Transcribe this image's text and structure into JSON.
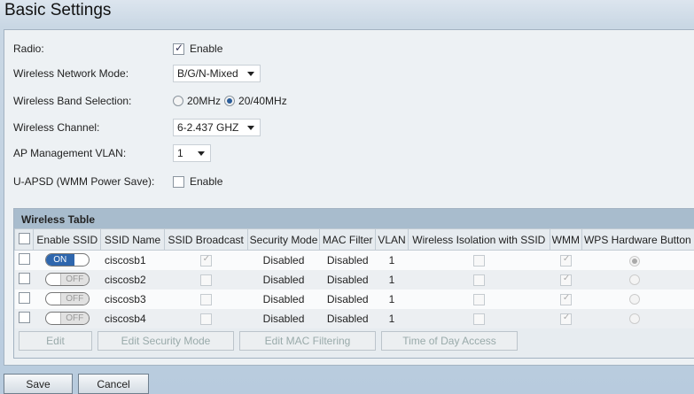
{
  "title": "Basic Settings",
  "form": {
    "radio": {
      "label": "Radio:",
      "checkbox_label": "Enable",
      "checked": true
    },
    "mode": {
      "label": "Wireless Network Mode:",
      "value": "B/G/N-Mixed"
    },
    "band": {
      "label": "Wireless Band Selection:",
      "options": [
        "20MHz",
        "20/40MHz"
      ],
      "selected": "20/40MHz"
    },
    "channel": {
      "label": "Wireless Channel:",
      "value": "6-2.437 GHZ"
    },
    "vlan": {
      "label": "AP Management VLAN:",
      "value": "1"
    },
    "uapsd": {
      "label": "U-APSD (WMM Power Save):",
      "checkbox_label": "Enable",
      "checked": false
    }
  },
  "table": {
    "title": "Wireless Table",
    "columns": [
      "Enable SSID",
      "SSID Name",
      "SSID Broadcast",
      "Security Mode",
      "MAC Filter",
      "VLAN",
      "Wireless Isolation with SSID",
      "WMM",
      "WPS Hardware Button"
    ],
    "rows": [
      {
        "enabled": "ON",
        "name": "ciscosb1",
        "broadcast": true,
        "security": "Disabled",
        "mac": "Disabled",
        "vlan": "1",
        "isolation": false,
        "wmm": true,
        "wps": true
      },
      {
        "enabled": "OFF",
        "name": "ciscosb2",
        "broadcast": false,
        "security": "Disabled",
        "mac": "Disabled",
        "vlan": "1",
        "isolation": false,
        "wmm": true,
        "wps": false
      },
      {
        "enabled": "OFF",
        "name": "ciscosb3",
        "broadcast": false,
        "security": "Disabled",
        "mac": "Disabled",
        "vlan": "1",
        "isolation": false,
        "wmm": true,
        "wps": false
      },
      {
        "enabled": "OFF",
        "name": "ciscosb4",
        "broadcast": false,
        "security": "Disabled",
        "mac": "Disabled",
        "vlan": "1",
        "isolation": false,
        "wmm": true,
        "wps": false
      }
    ],
    "buttons": [
      "Edit",
      "Edit Security Mode",
      "Edit MAC Filtering",
      "Time of Day Access"
    ]
  },
  "actions": {
    "save": "Save",
    "cancel": "Cancel"
  }
}
